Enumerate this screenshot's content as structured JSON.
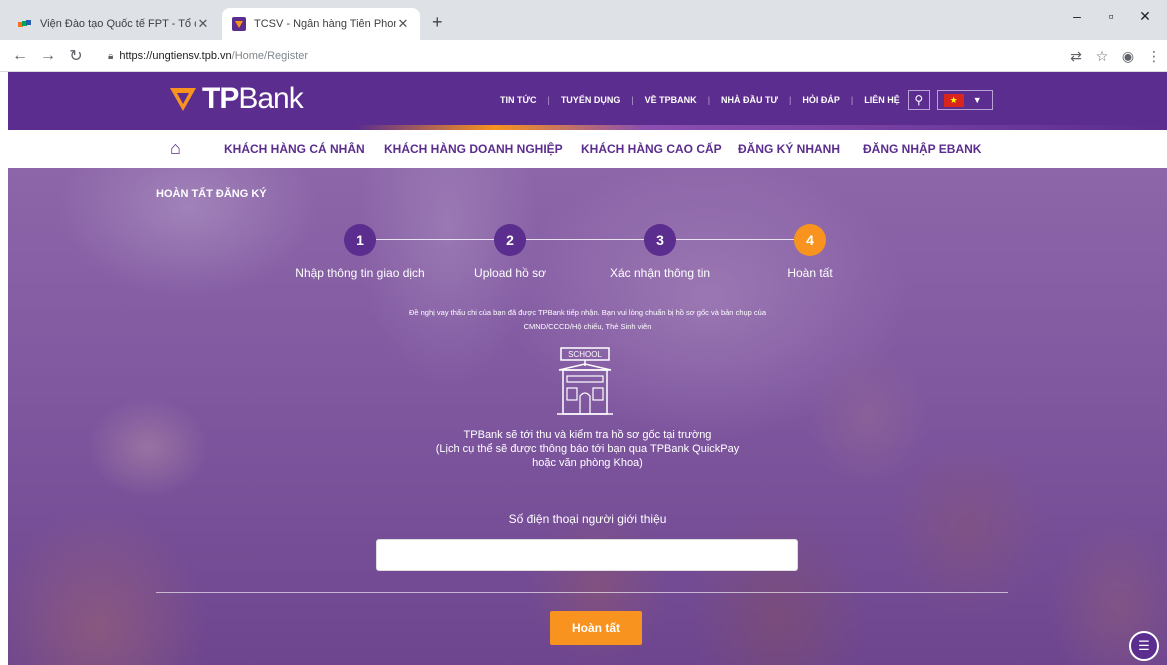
{
  "browser": {
    "tabs": [
      {
        "title": "Viện Đào tạo Quốc tế FPT - Tổ ch",
        "active": false
      },
      {
        "title": "TCSV - Ngân hàng Tiên Phong | T",
        "active": true
      }
    ],
    "new_tab": "+",
    "url_host": "https://ungtiensv.tpb.vn",
    "url_path": "/Home/Register",
    "window_controls": {
      "minimize": "–",
      "maximize": "▫",
      "close": "✕"
    }
  },
  "brand": {
    "logo_tp": "TP",
    "logo_bank": "Bank",
    "primary_color": "#5b2d8e",
    "accent_color": "#f7931e"
  },
  "top_nav": [
    "TIN TỨC",
    "TUYỂN DỤNG",
    "VỀ TPBANK",
    "NHÀ ĐẦU TƯ",
    "HỎI ĐÁP",
    "LIÊN HỆ"
  ],
  "main_nav": [
    "KHÁCH HÀNG CÁ NHÂN",
    "KHÁCH HÀNG DOANH NGHIỆP",
    "KHÁCH HÀNG CAO CẤP",
    "ĐĂNG KÝ NHANH",
    "ĐĂNG NHẬP EBANK"
  ],
  "page": {
    "title": "HOÀN TẤT ĐĂNG KÝ"
  },
  "steps": [
    {
      "number": "1",
      "label": "Nhập thông tin giao dịch"
    },
    {
      "number": "2",
      "label": "Upload hồ sơ"
    },
    {
      "number": "3",
      "label": "Xác nhận thông tin"
    },
    {
      "number": "4",
      "label": "Hoàn tất",
      "current": true
    }
  ],
  "notice": {
    "line1": "Đề nghị vay thấu chi của bạn đã được TPBank tiếp nhận. Bạn vui lòng chuẩn bị hồ sơ gốc và bản chụp của",
    "line2": "CMND/CCCD/Hộ chiếu, Thẻ Sinh viên"
  },
  "school_label": "SCHOOL",
  "info": {
    "line1": "TPBank sẽ tới thu và kiểm tra hồ sơ gốc tại trường",
    "line2": "(Lịch cụ thể sẽ được thông báo tới bạn qua TPBank QuickPay",
    "line3": "hoặc văn phòng Khoa)"
  },
  "referrer": {
    "label": "Số điện thoại người giới thiệu",
    "value": ""
  },
  "submit_label": "Hoàn tất"
}
